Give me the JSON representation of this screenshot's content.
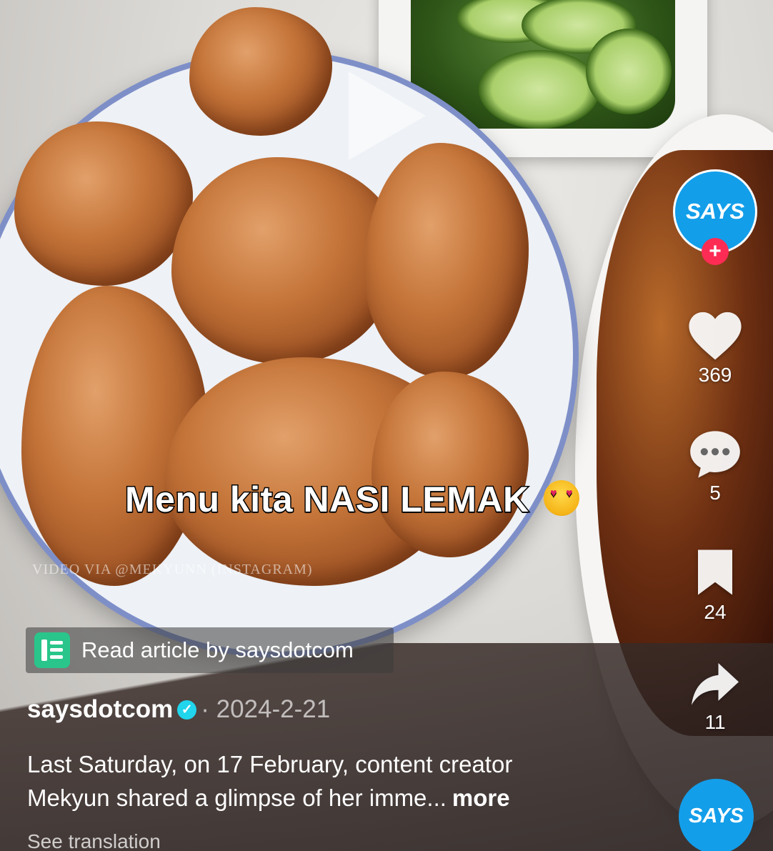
{
  "video": {
    "caption_text": "Menu kita NASI LEMAK",
    "caption_emoji": "heart-eyes-emoji",
    "watermark": "VIDEO VIA @MEKYUNN (INSTAGRAM)"
  },
  "article_link": {
    "label": "Read article by saysdotcom",
    "icon": "article-icon"
  },
  "post": {
    "username": "saysdotcom",
    "date": "· 2024-2-21",
    "description_line1": "Last Saturday, on 17 February, content creator",
    "description_line2": "Mekyun shared a glimpse of her imme...",
    "more_label": "more",
    "see_translation": "See translation"
  },
  "rail": {
    "avatar_label": "SAYS",
    "follow_symbol": "+",
    "likes": "369",
    "comments": "5",
    "bookmarks": "24",
    "shares": "11",
    "sound_label": "SAYS"
  },
  "colors": {
    "brand_blue": "#139eea",
    "follow_red": "#fe2c55",
    "verified_cyan": "#20d5ec",
    "article_green": "#2ac58a"
  }
}
